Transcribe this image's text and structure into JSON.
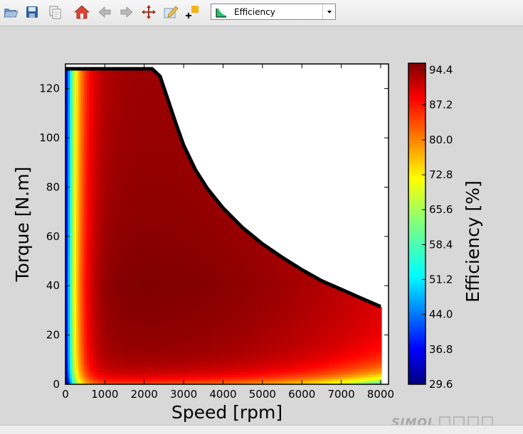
{
  "toolbar": {
    "icons": [
      "open-folder-icon",
      "save-disk-icon",
      "copy-pages-icon",
      "home-icon",
      "back-arrow-icon",
      "forward-arrow-icon",
      "pan-move-icon",
      "edit-plot-icon",
      "add-item-icon"
    ],
    "select_value": "Efficiency",
    "select_icon": "efficiency-map-icon"
  },
  "watermark": {
    "logo_text": "SIMOL西莫论坛"
  },
  "chart_data": {
    "type": "heatmap",
    "title": "",
    "xlabel": "Speed [rpm]",
    "ylabel": "Torque [N.m]",
    "xlim": [
      0,
      8200
    ],
    "ylim": [
      0,
      130
    ],
    "x_ticks": [
      0,
      1000,
      2000,
      3000,
      4000,
      5000,
      6000,
      7000,
      8000
    ],
    "y_ticks": [
      0,
      20,
      40,
      60,
      80,
      100,
      120
    ],
    "grid": false,
    "colorbar": {
      "label": "Efficiency [%]",
      "min": 29.6,
      "max": 95.8,
      "ticks": [
        "29.6",
        "36.8",
        "44.0",
        "51.2",
        "58.4",
        "65.6",
        "72.8",
        "80.0",
        "87.2",
        "94.4"
      ],
      "colormap": "jet"
    },
    "max_torque_envelope": {
      "speed": [
        0,
        2200,
        2400,
        2600,
        2800,
        3000,
        3300,
        3600,
        4000,
        4500,
        5000,
        5500,
        6000,
        6500,
        7000,
        7500,
        8000
      ],
      "torque": [
        128,
        128,
        125,
        115.5,
        106,
        97,
        87,
        79.5,
        71.5,
        63.5,
        57,
        51.5,
        46.5,
        42,
        38.5,
        35,
        31.5
      ]
    },
    "efficiency_samples": [
      {
        "speed": 50,
        "torque": 120,
        "efficiency": 36
      },
      {
        "speed": 200,
        "torque": 120,
        "efficiency": 52
      },
      {
        "speed": 400,
        "torque": 120,
        "efficiency": 74
      },
      {
        "speed": 1000,
        "torque": 120,
        "efficiency": 88
      },
      {
        "speed": 2000,
        "torque": 120,
        "efficiency": 91
      },
      {
        "speed": 100,
        "torque": 60,
        "efficiency": 56
      },
      {
        "speed": 500,
        "torque": 60,
        "efficiency": 88
      },
      {
        "speed": 3000,
        "torque": 45,
        "efficiency": 95.5
      },
      {
        "speed": 4000,
        "torque": 40,
        "efficiency": 94
      },
      {
        "speed": 6000,
        "torque": 30,
        "efficiency": 92
      },
      {
        "speed": 2000,
        "torque": 5,
        "efficiency": 84
      },
      {
        "speed": 6000,
        "torque": 5,
        "efficiency": 83
      },
      {
        "speed": 8000,
        "torque": 2,
        "efficiency": 66
      },
      {
        "speed": 8000,
        "torque": 8,
        "efficiency": 76
      },
      {
        "speed": 8000,
        "torque": 20,
        "efficiency": 86
      }
    ]
  }
}
